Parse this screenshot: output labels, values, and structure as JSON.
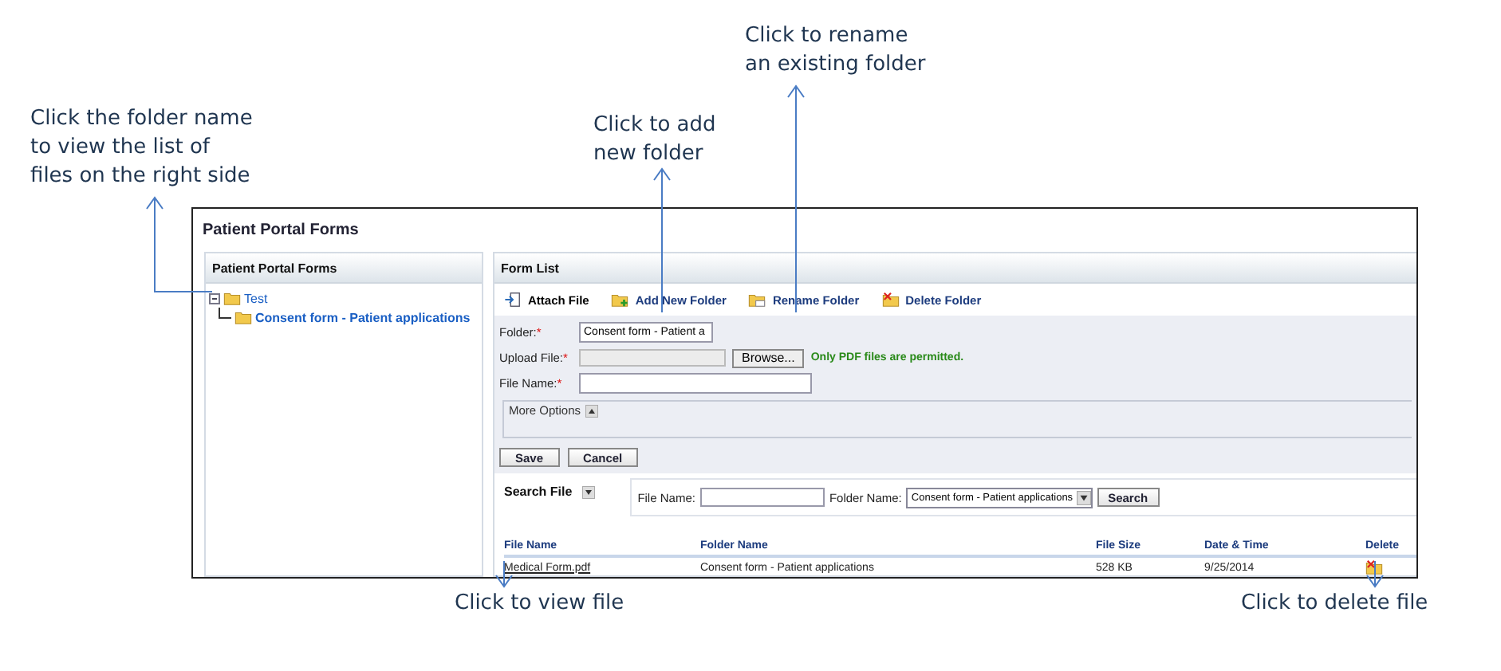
{
  "callouts": [
    {
      "kind": "tree",
      "lines": [
        "Click the folder name",
        "to view the list of",
        "files on the right side"
      ]
    },
    {
      "kind": "add",
      "lines": [
        "Click to add",
        "new folder"
      ]
    },
    {
      "kind": "rename",
      "lines": [
        "Click to rename",
        "an existing folder"
      ]
    },
    {
      "kind": "view",
      "lines": [
        "Click to view file"
      ]
    },
    {
      "kind": "delete",
      "lines": [
        "Click to delete file"
      ]
    }
  ],
  "window": {
    "title": "Patient Portal Forms"
  },
  "folder_panel": {
    "title": "Patient Portal Forms",
    "tree": [
      {
        "label": "Test",
        "expanded": true,
        "children": [
          {
            "label": "Consent form - Patient applications"
          }
        ]
      }
    ]
  },
  "form_list": {
    "title": "Form List",
    "toolbar": [
      {
        "label": "Attach File",
        "kind": "attach",
        "selected": true
      },
      {
        "label": "Add New Folder",
        "kind": "add",
        "selected": false
      },
      {
        "label": "Rename Folder",
        "kind": "rename",
        "selected": false
      },
      {
        "label": "Delete Folder",
        "kind": "delete",
        "selected": false
      }
    ],
    "fields": [
      {
        "label": "Folder:",
        "required_mark": "*",
        "kind": "text",
        "value": "Consent form - Patient a"
      },
      {
        "label": "Upload File:",
        "required_mark": "*",
        "kind": "file",
        "button": "Browse...",
        "hint": "Only PDF files are permitted."
      },
      {
        "label": "File Name:",
        "required_mark": "*",
        "kind": "wide"
      }
    ],
    "more_options": {
      "label": "More Options",
      "expanded": false
    },
    "buttons": [
      "Save",
      "Cancel"
    ],
    "search": {
      "title": "Search File",
      "expanded": true,
      "file_name_label": "File Name:",
      "folder_name_label": "Folder Name:",
      "folder_name_value": "Consent form - Patient applications",
      "button": "Search"
    },
    "table": {
      "columns": [
        "File Name",
        "Folder Name",
        "File Size",
        "Date & Time",
        "Delete"
      ],
      "rows": [
        {
          "file_name": "Medical Form.pdf",
          "folder_name": "Consent form - Patient applications",
          "file_size": "528 KB",
          "date_time": "9/25/2014"
        }
      ]
    }
  }
}
